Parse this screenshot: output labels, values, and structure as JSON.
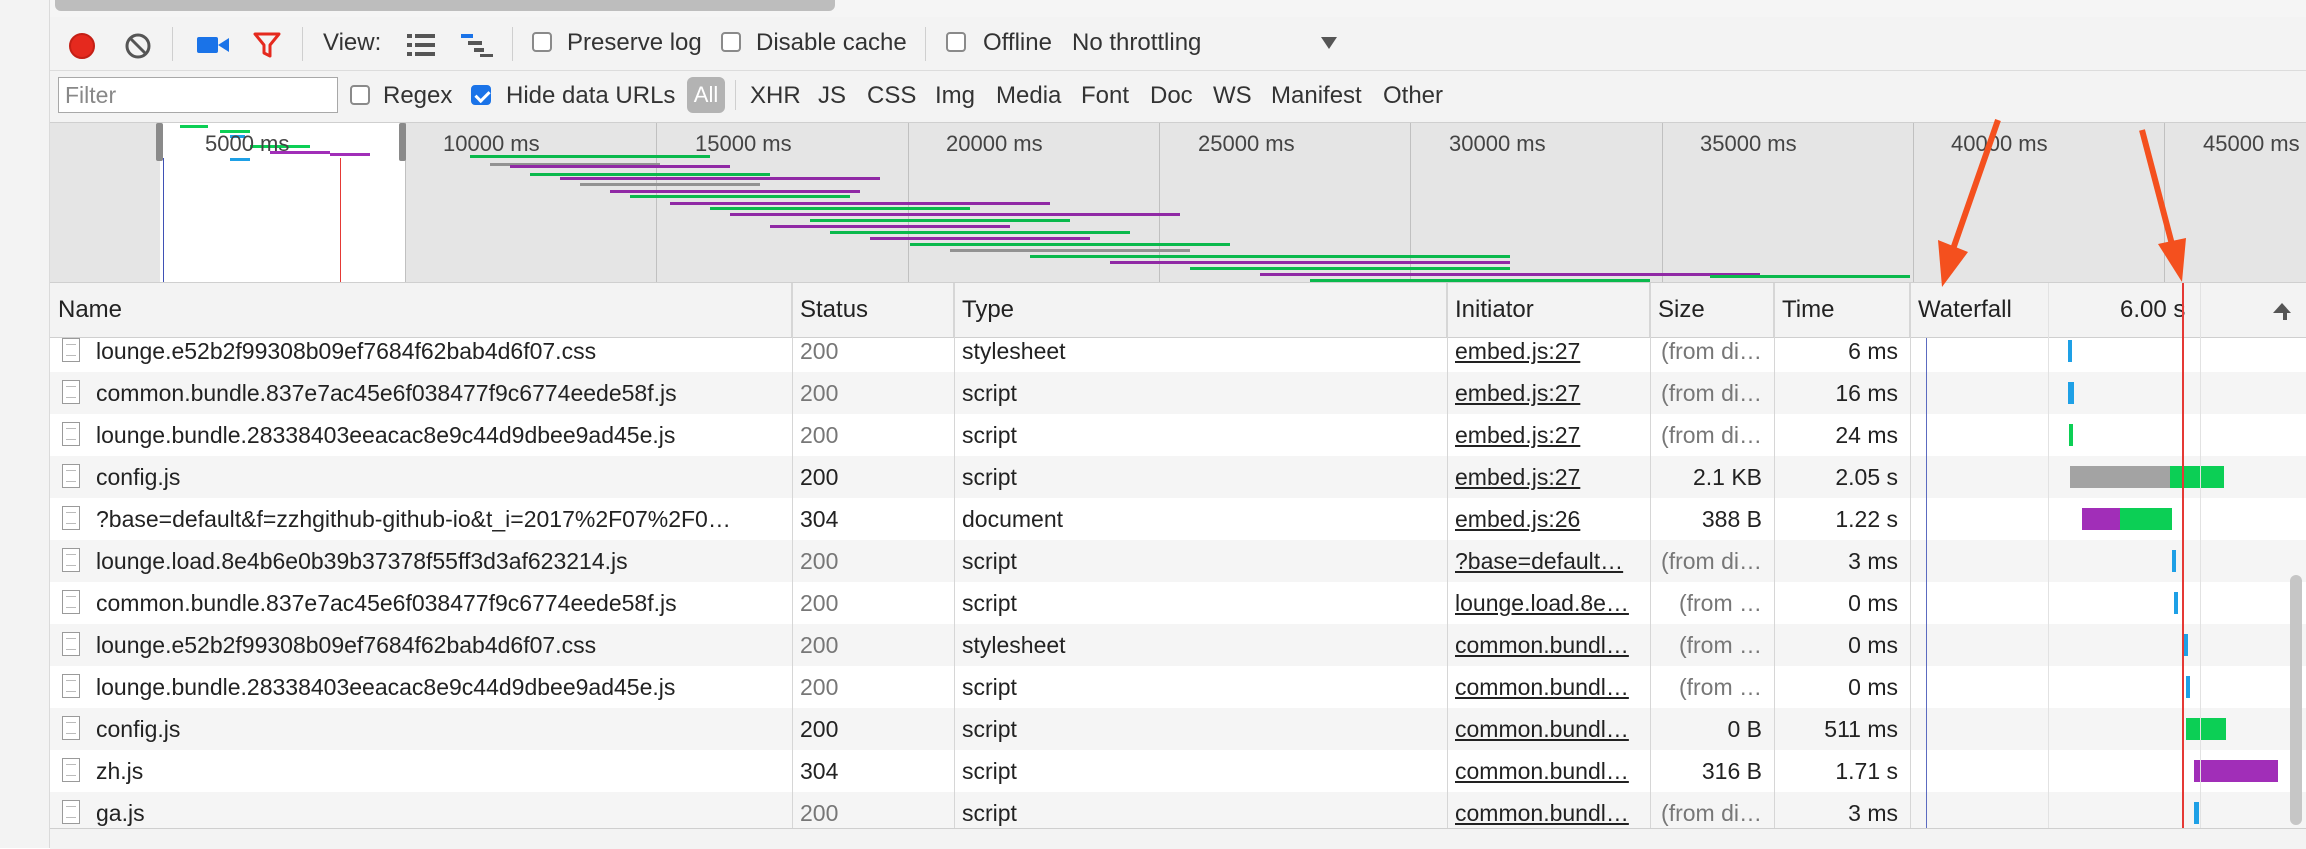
{
  "toolbar": {
    "view_label": "View:",
    "preserve_log": {
      "label": "Preserve log",
      "checked": false
    },
    "disable_cache": {
      "label": "Disable cache",
      "checked": false
    },
    "offline": {
      "label": "Offline",
      "checked": false
    },
    "throttling": "No throttling"
  },
  "filter_bar": {
    "placeholder": "Filter",
    "regex": {
      "label": "Regex",
      "checked": false
    },
    "hide_data_urls": {
      "label": "Hide data URLs",
      "checked": true
    },
    "types": [
      "All",
      "XHR",
      "JS",
      "CSS",
      "Img",
      "Media",
      "Font",
      "Doc",
      "WS",
      "Manifest",
      "Other"
    ]
  },
  "overview": {
    "ticks": [
      "5000 ms",
      "10000 ms",
      "15000 ms",
      "20000 ms",
      "25000 ms",
      "30000 ms",
      "35000 ms",
      "40000 ms",
      "45000 ms"
    ]
  },
  "columns": {
    "name": "Name",
    "status": "Status",
    "type": "Type",
    "initiator": "Initiator",
    "size": "Size",
    "time": "Time",
    "waterfall": "Waterfall",
    "waterfall_time": "6.00 s"
  },
  "rows": [
    {
      "name": "lounge.e52b2f99308b09ef7684f62bab4d6f07.css",
      "status": "200",
      "type": "stylesheet",
      "initiator": "embed.js:27",
      "size": "(from di…",
      "time": "6 ms",
      "cached": true
    },
    {
      "name": "common.bundle.837e7ac45e6f038477f9c6774eede58f.js",
      "status": "200",
      "type": "script",
      "initiator": "embed.js:27",
      "size": "(from di…",
      "time": "16 ms",
      "cached": true
    },
    {
      "name": "lounge.bundle.28338403eeacac8e9c44d9dbee9ad45e.js",
      "status": "200",
      "type": "script",
      "initiator": "embed.js:27",
      "size": "(from di…",
      "time": "24 ms",
      "cached": true
    },
    {
      "name": "config.js",
      "status": "200",
      "type": "script",
      "initiator": "embed.js:27",
      "size": "2.1 KB",
      "time": "2.05 s",
      "cached": false
    },
    {
      "name": "?base=default&f=zzhgithub-github-io&t_i=2017%2F07%2F0…",
      "status": "304",
      "type": "document",
      "initiator": "embed.js:26",
      "size": "388 B",
      "time": "1.22 s",
      "cached": false
    },
    {
      "name": "lounge.load.8e4b6e0b39b37378f55ff3d3af623214.js",
      "status": "200",
      "type": "script",
      "initiator": "?base=default…",
      "size": "(from di…",
      "time": "3 ms",
      "cached": true
    },
    {
      "name": "common.bundle.837e7ac45e6f038477f9c6774eede58f.js",
      "status": "200",
      "type": "script",
      "initiator": "lounge.load.8e…",
      "size": "(from …",
      "time": "0 ms",
      "cached": true
    },
    {
      "name": "lounge.e52b2f99308b09ef7684f62bab4d6f07.css",
      "status": "200",
      "type": "stylesheet",
      "initiator": "common.bundl…",
      "size": "(from …",
      "time": "0 ms",
      "cached": true
    },
    {
      "name": "lounge.bundle.28338403eeacac8e9c44d9dbee9ad45e.js",
      "status": "200",
      "type": "script",
      "initiator": "common.bundl…",
      "size": "(from …",
      "time": "0 ms",
      "cached": true
    },
    {
      "name": "config.js",
      "status": "200",
      "type": "script",
      "initiator": "common.bundl…",
      "size": "0 B",
      "time": "511 ms",
      "cached": false
    },
    {
      "name": "zh.js",
      "status": "304",
      "type": "script",
      "initiator": "common.bundl…",
      "size": "316 B",
      "time": "1.71 s",
      "cached": false
    },
    {
      "name": "ga.js",
      "status": "200",
      "type": "script",
      "initiator": "common.bundl…",
      "size": "(from di…",
      "time": "3 ms",
      "cached": true
    }
  ],
  "colors": {
    "record": "#e5291e",
    "filter_icon": "#e5291e",
    "camera_icon": "#1a73e8",
    "annotation_arrow": "#f4501e",
    "waiting": "#a3a3a3",
    "download": "#0ccf55",
    "script_bar": "#a12eb8",
    "cached_bar": "#1ea0e6",
    "load_line": "#e53935",
    "dcl_line": "#5c6bc0"
  },
  "icons": [
    "record-icon",
    "clear-icon",
    "camera-icon",
    "filter-icon",
    "list-view-icon",
    "waterfall-view-icon",
    "dropdown-arrow-icon",
    "file-icon",
    "sort-icon"
  ]
}
